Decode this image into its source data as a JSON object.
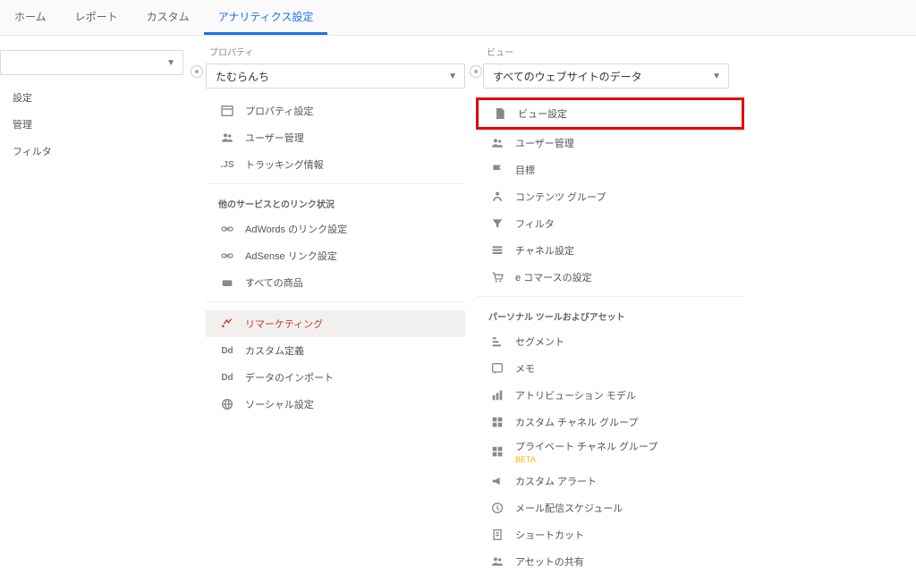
{
  "topnav": {
    "items": [
      "ホーム",
      "レポート",
      "カスタム",
      "アナリティクス設定"
    ],
    "activeIndex": 3
  },
  "account": {
    "label": "",
    "selector": "",
    "items": [
      "設定",
      "管理",
      "フィルタ"
    ]
  },
  "property": {
    "label": "プロパティ",
    "selector": "たむらんち",
    "items": [
      {
        "icon": "browser",
        "label": "プロパティ設定"
      },
      {
        "icon": "users",
        "label": "ユーザー管理"
      },
      {
        "icon": "js",
        "label": "トラッキング情報"
      }
    ],
    "sectionHeader": "他のサービスとのリンク状況",
    "items2": [
      {
        "icon": "link",
        "label": "AdWords のリンク設定"
      },
      {
        "icon": "link",
        "label": "AdSense リンク設定"
      },
      {
        "icon": "products",
        "label": "すべての商品"
      }
    ],
    "items3": [
      {
        "icon": "remarketing",
        "label": "リマーケティング",
        "active": true
      },
      {
        "icon": "dd",
        "label": "カスタム定義"
      },
      {
        "icon": "dd",
        "label": "データのインポート"
      },
      {
        "icon": "social",
        "label": "ソーシャル設定"
      }
    ]
  },
  "view": {
    "label": "ビュー",
    "selector": "すべてのウェブサイトのデータ",
    "items": [
      {
        "icon": "page",
        "label": "ビュー設定",
        "highlighted": true
      },
      {
        "icon": "users",
        "label": "ユーザー管理"
      },
      {
        "icon": "flag",
        "label": "目標"
      },
      {
        "icon": "content",
        "label": "コンテンツ グループ"
      },
      {
        "icon": "filter",
        "label": "フィルタ"
      },
      {
        "icon": "channel",
        "label": "チャネル設定"
      },
      {
        "icon": "cart",
        "label": "e コマースの設定"
      }
    ],
    "sectionHeader": "パーソナル ツールおよびアセット",
    "items2": [
      {
        "icon": "segment",
        "label": "セグメント"
      },
      {
        "icon": "memo",
        "label": "メモ"
      },
      {
        "icon": "attribution",
        "label": "アトリビューション モデル"
      },
      {
        "icon": "channelgroup",
        "label": "カスタム チャネル グループ"
      },
      {
        "icon": "channelgroup",
        "label": "プライベート チャネル グループ",
        "badge": "BETA"
      },
      {
        "icon": "alert",
        "label": "カスタム アラート"
      },
      {
        "icon": "mail",
        "label": "メール配信スケジュール"
      },
      {
        "icon": "shortcut",
        "label": "ショートカット"
      },
      {
        "icon": "share",
        "label": "アセットの共有"
      }
    ]
  }
}
